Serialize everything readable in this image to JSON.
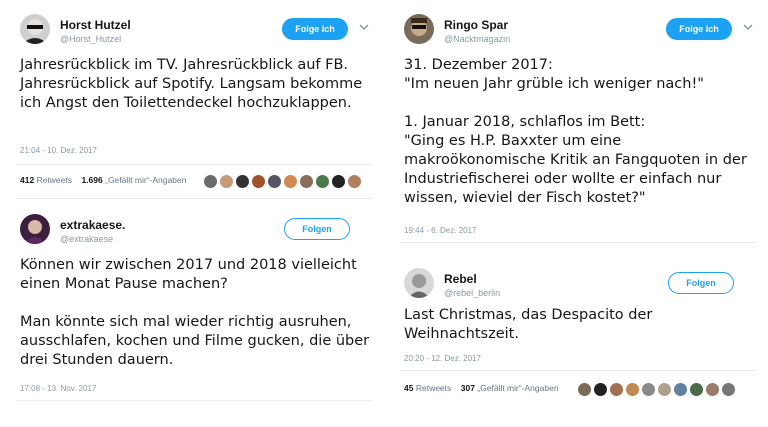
{
  "tweets": [
    {
      "name": "Horst Hutzel",
      "handle": "@Horst_Hutzel",
      "follow_label": "Folge ich",
      "text": "Jahresrückblick im TV. Jahresrückblick auf FB. Jahresrückblick auf Spotify. Langsam bekomme ich Angst den Toilettendeckel hochzuklappen.",
      "time": "21:04 - 10. Dez. 2017",
      "retweets": "412",
      "retweets_label": "Retweets",
      "likes": "1.696",
      "likes_label": "„Gefällt mir“-Angaben"
    },
    {
      "name": "extrakaese.",
      "handle": "@extrakaese",
      "follow_label": "Folgen",
      "text": "Können wir zwischen 2017 und 2018 vielleicht einen Monat Pause machen?\n\nMan könnte sich mal wieder richtig ausruhen, ausschlafen, kochen und Filme gucken, die über drei Stunden dauern.",
      "time": "17:08 - 13. Nov. 2017"
    },
    {
      "name": "Ringo Spar",
      "handle": "@Nacktmagazin",
      "follow_label": "Folge ich",
      "text": "31. Dezember 2017:\n\"Im neuen Jahr grüble ich weniger nach!\"\n\n1. Januar 2018, schlaflos im Bett:\n\"Ging es H.P. Baxxter um eine makroökonomische Kritik an Fangquoten in der Industriefischerei oder wollte er einfach nur wissen, wieviel der Fisch kostet?\"",
      "time": "19:44 - 6. Dez. 2017"
    },
    {
      "name": "Rebel",
      "handle": "@rebel_berlin",
      "follow_label": "Folgen",
      "text": "Last Christmas, das Despacito der Weihnachtszeit.",
      "time": "20:20 - 12. Dez. 2017",
      "retweets": "45",
      "retweets_label": "Retweets",
      "likes": "307",
      "likes_label": "„Gefällt mir“-Angaben"
    }
  ],
  "colors": {
    "accent": "#1da1f2",
    "muted": "#8899a6"
  }
}
